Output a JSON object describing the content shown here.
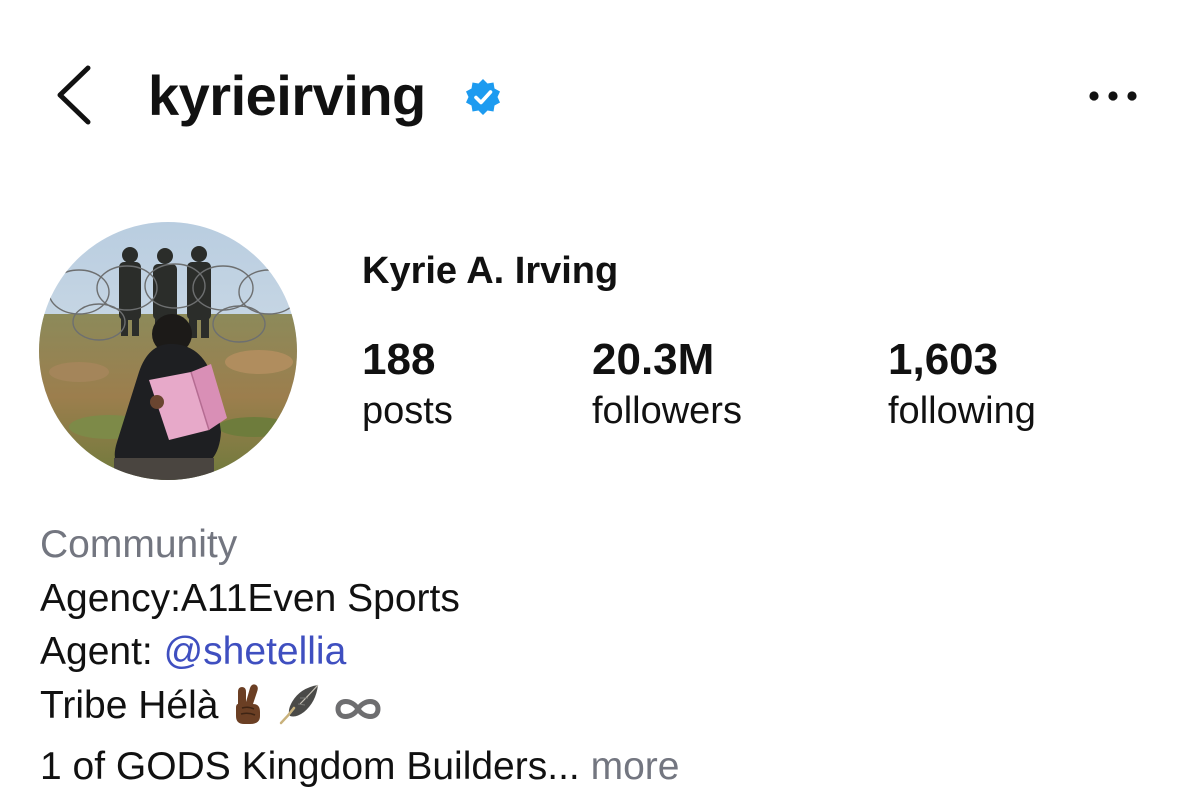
{
  "header": {
    "username": "kyrieirving",
    "verified_color": "#1d9bf0"
  },
  "profile": {
    "display_name": "Kyrie A. Irving",
    "stats": {
      "posts": {
        "value": "188",
        "label": "posts"
      },
      "followers": {
        "value": "20.3M",
        "label": "followers"
      },
      "following": {
        "value": "1,603",
        "label": "following"
      }
    }
  },
  "bio": {
    "category": "Community",
    "agency": "Agency:A11Even Sports",
    "agent_prefix": "Agent: ",
    "agent_mention": "@shetellia",
    "tribe": "Tribe Hélà",
    "tribe_icons": [
      "crossed-fingers-icon",
      "feather-icon",
      "infinity-icon"
    ],
    "last_line": "1 of GODS Kingdom Builders...",
    "more_label": "more",
    "mention_color": "#3f4fc0"
  }
}
